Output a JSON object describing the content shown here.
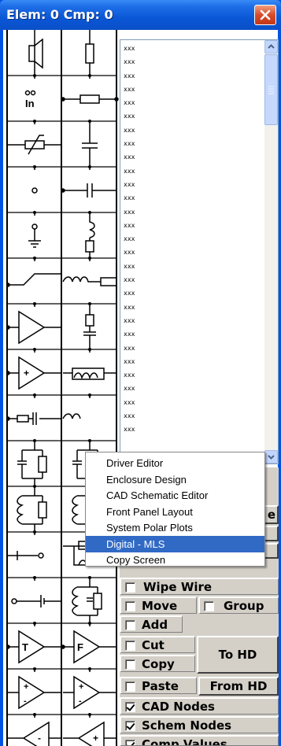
{
  "window": {
    "title": "Elem: 0 Cmp: 0",
    "close_glyph": "✕"
  },
  "palette": {
    "rows": [
      [
        "speaker-symbol-icon",
        "resistor-vertical-icon"
      ],
      [
        "input-node-icon",
        "resistor-horizontal-icon"
      ],
      [
        "variable-resistor-icon",
        "capacitor-vertical-icon"
      ],
      [
        "node-dot-icon",
        "capacitor-horizontal-icon"
      ],
      [
        "ground-symbol-icon",
        "inductor-vertical-icon"
      ],
      [
        "switch-symbol-icon",
        "inductor-resistor-icon"
      ],
      [
        "amplifier-icon",
        "rlc-vertical-icon"
      ],
      [
        "amplifier-plus-icon",
        "inductor-wave-icon"
      ],
      [
        "capacitor-series-icon",
        "inductor-series-icon"
      ],
      [
        "rc-parallel-icon",
        "rc-network-icon"
      ],
      [
        "lr-parallel-icon",
        "lr-network-icon"
      ],
      [
        "terminal-icon",
        "rl-parallel-icon"
      ],
      [
        "battery-icon",
        "lcr-network-icon"
      ],
      [
        "amp-t-icon",
        "amp-f-icon"
      ],
      [
        "diff-amp-left-icon",
        "diff-amp-right-icon"
      ],
      [
        "inv-amp-icon",
        "inv-amp-plus-icon"
      ]
    ]
  },
  "list": {
    "items": [
      "xxx",
      "xxx",
      "xxx",
      "xxx",
      "xxx",
      "xxx",
      "xxx",
      "xxx",
      "xxx",
      "xxx",
      "xxx",
      "xxx",
      "xxx",
      "xxx",
      "xxx",
      "xxx",
      "xxx",
      "xxx",
      "xxx",
      "xxx",
      "xxx",
      "xxx",
      "xxx",
      "xxx",
      "xxx",
      "xxx",
      "xxx",
      "xxx",
      "xxx"
    ]
  },
  "menu": {
    "items": [
      {
        "label": "Driver Editor",
        "selected": false
      },
      {
        "label": "Enclosure Design",
        "selected": false
      },
      {
        "label": "CAD Schematic Editor",
        "selected": false
      },
      {
        "label": "Front Panel Layout",
        "selected": false
      },
      {
        "label": "System Polar Plots",
        "selected": false
      },
      {
        "label": "Digital - MLS",
        "selected": true
      },
      {
        "label": "Copy Screen",
        "selected": false
      }
    ]
  },
  "controls": {
    "partial_e": "e",
    "wipe_wire": "Wipe Wire",
    "move": "Move",
    "group": "Group",
    "add": "Add",
    "cut": "Cut",
    "copy": "Copy",
    "to_hd": "To HD",
    "paste": "Paste",
    "from_hd": "From HD",
    "cad_nodes": "CAD Nodes",
    "schem_nodes": "Schem Nodes",
    "comp_values": "Comp Values"
  },
  "checks": {
    "wipe_wire": false,
    "move": false,
    "group": false,
    "add": false,
    "cut": false,
    "copy": false,
    "paste": false,
    "cad_nodes": true,
    "schem_nodes": true,
    "comp_values": true
  }
}
